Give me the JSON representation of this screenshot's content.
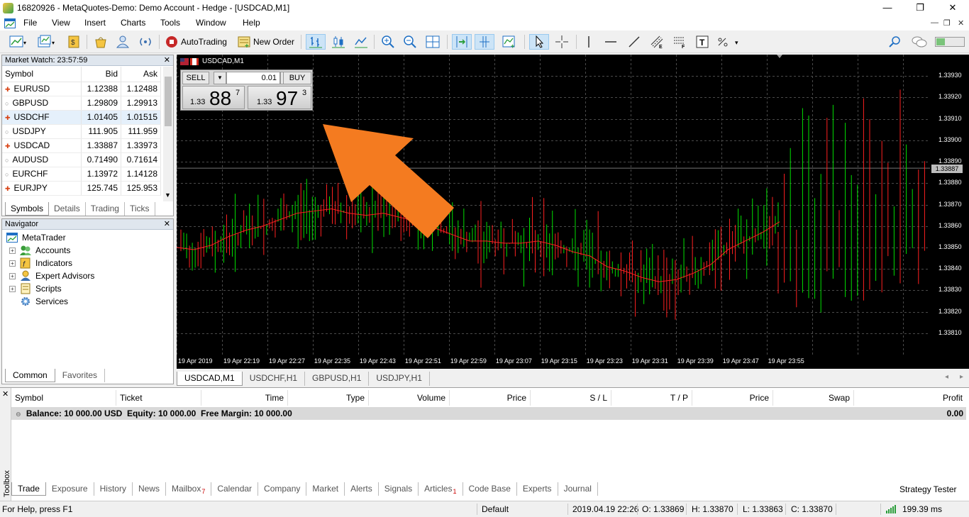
{
  "window": {
    "title": "16820926 - MetaQuotes-Demo: Demo Account - Hedge - [USDCAD,M1]",
    "minimize": "—",
    "restore": "❐",
    "close": "✕"
  },
  "menu": [
    "File",
    "View",
    "Insert",
    "Charts",
    "Tools",
    "Window",
    "Help"
  ],
  "toolbar": {
    "autotrading_label": "AutoTrading",
    "new_order_label": "New Order"
  },
  "market_watch": {
    "title": "Market Watch: 23:57:59",
    "headers": {
      "symbol": "Symbol",
      "bid": "Bid",
      "ask": "Ask"
    },
    "rows": [
      {
        "symbol": "EURUSD",
        "bid": "1.12388",
        "ask": "1.12488",
        "dir": "up"
      },
      {
        "symbol": "GBPUSD",
        "bid": "1.29809",
        "ask": "1.29913",
        "dir": "flat"
      },
      {
        "symbol": "USDCHF",
        "bid": "1.01405",
        "ask": "1.01515",
        "dir": "up"
      },
      {
        "symbol": "USDJPY",
        "bid": "111.905",
        "ask": "111.959",
        "dir": "flat"
      },
      {
        "symbol": "USDCAD",
        "bid": "1.33887",
        "ask": "1.33973",
        "dir": "up"
      },
      {
        "symbol": "AUDUSD",
        "bid": "0.71490",
        "ask": "0.71614",
        "dir": "flat"
      },
      {
        "symbol": "EURCHF",
        "bid": "1.13972",
        "ask": "1.14128",
        "dir": "flat"
      },
      {
        "symbol": "EURJPY",
        "bid": "125.745",
        "ask": "125.953",
        "dir": "up"
      }
    ],
    "tabs": [
      "Symbols",
      "Details",
      "Trading",
      "Ticks"
    ]
  },
  "navigator": {
    "title": "Navigator",
    "root": "MetaTrader",
    "items": [
      "Accounts",
      "Indicators",
      "Expert Advisors",
      "Scripts",
      "Services"
    ],
    "tabs": [
      "Common",
      "Favorites"
    ]
  },
  "chart": {
    "caption": "USDCAD,M1",
    "one_click": {
      "sell_label": "SELL",
      "buy_label": "BUY",
      "volume": "0.01",
      "sell_prefix": "1.33",
      "sell_big": "88",
      "sell_sup": "7",
      "buy_prefix": "1.33",
      "buy_big": "97",
      "buy_sup": "3"
    },
    "current_price_label": "1.33887",
    "colors": {
      "bull": "#00e000",
      "bear": "#ff2020",
      "ma": "#ff2020",
      "grid": "#4a4a4a",
      "arrow": "#f47b20"
    }
  },
  "chart_data": {
    "type": "candlestick",
    "title": "USDCAD,M1",
    "ylim": [
      1.338,
      1.3394
    ],
    "y_ticks": [
      "1.33930",
      "1.33920",
      "1.33910",
      "1.33900",
      "1.33890",
      "1.33880",
      "1.33870",
      "1.33860",
      "1.33850",
      "1.33840",
      "1.33830",
      "1.33820",
      "1.33810"
    ],
    "x_ticks": [
      "19 Apr 2019",
      "19 Apr 22:19",
      "19 Apr 22:27",
      "19 Apr 22:35",
      "19 Apr 22:43",
      "19 Apr 22:51",
      "19 Apr 22:59",
      "19 Apr 23:07",
      "19 Apr 23:15",
      "19 Apr 23:23",
      "19 Apr 23:31",
      "19 Apr 23:39",
      "19 Apr 23:47",
      "19 Apr 23:55"
    ],
    "ma_close": [
      1.3385,
      1.33849,
      1.33851,
      1.33855,
      1.33858,
      1.3386,
      1.33863,
      1.33866,
      1.33867,
      1.33868,
      1.33866,
      1.33865,
      1.33866,
      1.33864,
      1.33862,
      1.33859,
      1.33856,
      1.33853,
      1.33853,
      1.33852,
      1.33852,
      1.33853,
      1.33851,
      1.33848,
      1.33846,
      1.33841,
      1.33839,
      1.33836,
      1.33834,
      1.33835,
      1.33838,
      1.33842,
      1.33849,
      1.33853,
      1.33857,
      1.33862
    ]
  },
  "chart_tabs": [
    "USDCAD,M1",
    "USDCHF,H1",
    "GBPUSD,H1",
    "USDJPY,H1"
  ],
  "toolbox": {
    "side_label": "Toolbox",
    "columns": [
      "Symbol",
      "Ticket",
      "Time",
      "Type",
      "Volume",
      "Price",
      "S / L",
      "T / P",
      "Price",
      "Swap",
      "Profit"
    ],
    "balance_text": "Balance: 10 000.00 USD  Equity: 10 000.00  Free Margin: 10 000.00",
    "profit_total": "0.00",
    "tabs": [
      {
        "label": "Trade",
        "badge": ""
      },
      {
        "label": "Exposure",
        "badge": ""
      },
      {
        "label": "History",
        "badge": ""
      },
      {
        "label": "News",
        "badge": ""
      },
      {
        "label": "Mailbox",
        "badge": "7"
      },
      {
        "label": "Calendar",
        "badge": ""
      },
      {
        "label": "Company",
        "badge": ""
      },
      {
        "label": "Market",
        "badge": ""
      },
      {
        "label": "Alerts",
        "badge": ""
      },
      {
        "label": "Signals",
        "badge": ""
      },
      {
        "label": "Articles",
        "badge": "1"
      },
      {
        "label": "Code Base",
        "badge": ""
      },
      {
        "label": "Experts",
        "badge": ""
      },
      {
        "label": "Journal",
        "badge": ""
      }
    ],
    "strategy_tester": "Strategy Tester"
  },
  "status": {
    "help": "For Help, press F1",
    "profile": "Default",
    "datetime": "2019.04.19 22:26",
    "open": "O: 1.33869",
    "high": "H: 1.33870",
    "low": "L: 1.33863",
    "close": "C: 1.33870",
    "ping": "199.39 ms"
  }
}
